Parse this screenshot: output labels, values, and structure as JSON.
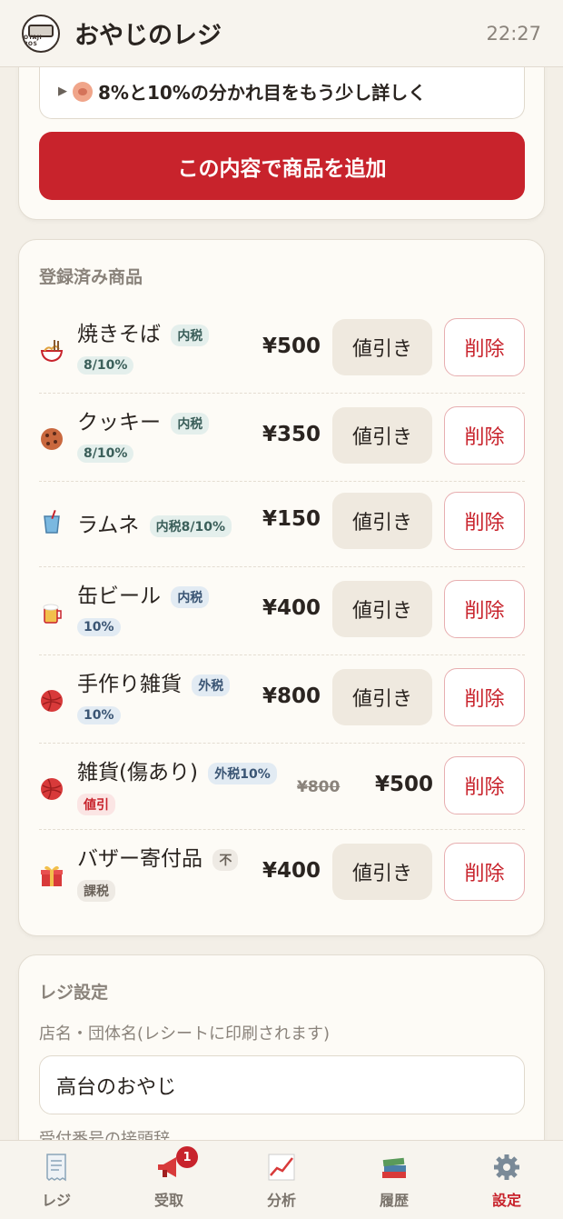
{
  "header": {
    "title": "おやじのレジ",
    "time": "22:27",
    "logo_text": "OYAJI POS"
  },
  "add_form": {
    "details_summary": "8%と10%の分かれ目をもう少し詳しく",
    "add_button": "この内容で商品を追加"
  },
  "products": {
    "section_title": "登録済み商品",
    "discount_label": "値引き",
    "delete_label": "削除",
    "items": [
      {
        "name": "焼きそば",
        "tag1": "内税",
        "tag2": "8/10%",
        "price": "¥500",
        "icon": "noodles-icon"
      },
      {
        "name": "クッキー",
        "tag1": "内税",
        "tag2": "8/10%",
        "price": "¥350",
        "icon": "cookie-icon"
      },
      {
        "name": "ラムネ",
        "tag1": "内税8/10%",
        "price": "¥150",
        "icon": "drink-icon"
      },
      {
        "name": "缶ビール",
        "tag1": "内税",
        "tag2": "10%",
        "price": "¥400",
        "icon": "beer-icon"
      },
      {
        "name": "手作り雑貨",
        "tag1": "外税",
        "tag2": "10%",
        "price": "¥800",
        "icon": "yarn-icon"
      },
      {
        "name": "雑貨(傷あり)",
        "tag1": "外税10%",
        "tag2": "値引",
        "old_price": "¥800",
        "price": "¥500",
        "icon": "yarn-icon"
      },
      {
        "name": "バザー寄付品",
        "tag1": "不",
        "tag2": "課税",
        "price": "¥400",
        "icon": "gift-icon"
      }
    ]
  },
  "settings": {
    "section_title": "レジ設定",
    "store_name_label": "店名・団体名(レシートに印刷されます)",
    "store_name_value": "高台のおやじ",
    "prefix_label": "受付番号の接頭辞"
  },
  "nav": {
    "items": [
      {
        "label": "レジ",
        "icon": "receipt-icon"
      },
      {
        "label": "受取",
        "icon": "megaphone-icon",
        "badge": "1"
      },
      {
        "label": "分析",
        "icon": "chart-icon"
      },
      {
        "label": "履歴",
        "icon": "books-icon"
      },
      {
        "label": "設定",
        "icon": "gear-icon"
      }
    ]
  },
  "colors": {
    "accent": "#c8232c",
    "background": "#f3efe7",
    "card": "#fdfbf6"
  }
}
